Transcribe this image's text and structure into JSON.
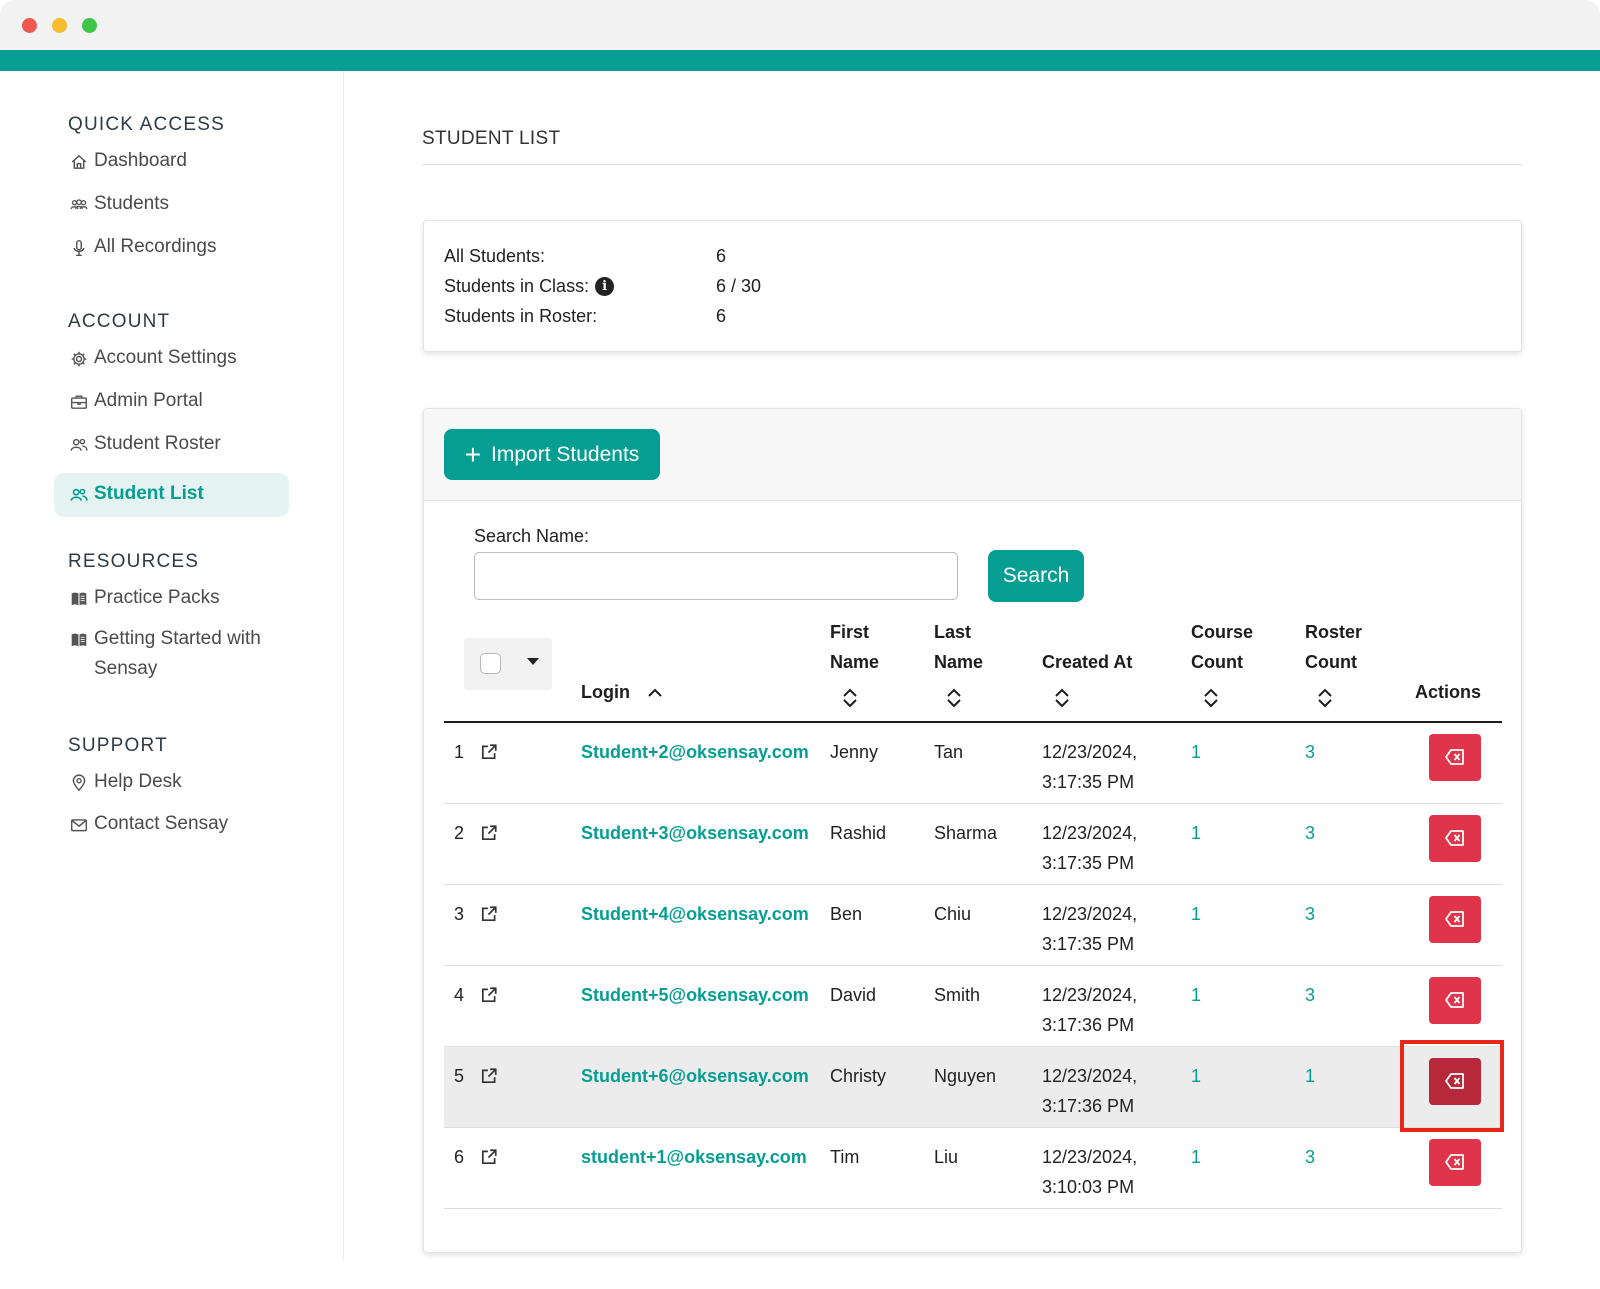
{
  "sidebar": {
    "sections": [
      {
        "title": "QUICK ACCESS",
        "items": [
          {
            "label": "Dashboard",
            "icon": "home-icon"
          },
          {
            "label": "Students",
            "icon": "users-icon"
          },
          {
            "label": "All Recordings",
            "icon": "microphone-icon"
          }
        ]
      },
      {
        "title": "ACCOUNT",
        "items": [
          {
            "label": "Account Settings",
            "icon": "gear-icon"
          },
          {
            "label": "Admin Portal",
            "icon": "briefcase-icon"
          },
          {
            "label": "Student Roster",
            "icon": "people-icon"
          },
          {
            "label": "Student List",
            "icon": "people-icon",
            "active": true
          }
        ]
      },
      {
        "title": "RESOURCES",
        "items": [
          {
            "label": "Practice Packs",
            "icon": "book-icon"
          },
          {
            "label": "Getting Started with Sensay",
            "icon": "book-icon"
          }
        ]
      },
      {
        "title": "SUPPORT",
        "items": [
          {
            "label": "Help Desk",
            "icon": "location-icon"
          },
          {
            "label": "Contact Sensay",
            "icon": "mail-icon"
          }
        ]
      }
    ]
  },
  "page": {
    "title": "STUDENT LIST"
  },
  "stats": {
    "all_students_label": "All Students:",
    "all_students_value": "6",
    "in_class_label": "Students in Class:",
    "in_class_value": "6 / 30",
    "in_roster_label": "Students in Roster:",
    "in_roster_value": "6"
  },
  "toolbar": {
    "import_label": "Import Students"
  },
  "search": {
    "label": "Search Name:",
    "value": "",
    "placeholder": "",
    "button_label": "Search"
  },
  "table": {
    "headers": {
      "login": "Login",
      "first_name": [
        "First",
        "Name"
      ],
      "last_name": [
        "Last",
        "Name"
      ],
      "created_at": "Created At",
      "course_count": [
        "Course",
        "Count"
      ],
      "roster_count": [
        "Roster",
        "Count"
      ],
      "actions": "Actions"
    },
    "rows": [
      {
        "num": "1",
        "login": "Student+2@oksensay.com",
        "first": "Jenny",
        "last": "Tan",
        "date": "12/23/2024,",
        "time": "3:17:35 PM",
        "course": "1",
        "roster": "3"
      },
      {
        "num": "2",
        "login": "Student+3@oksensay.com",
        "first": "Rashid",
        "last": "Sharma",
        "date": "12/23/2024,",
        "time": "3:17:35 PM",
        "course": "1",
        "roster": "3"
      },
      {
        "num": "3",
        "login": "Student+4@oksensay.com",
        "first": "Ben",
        "last": "Chiu",
        "date": "12/23/2024,",
        "time": "3:17:35 PM",
        "course": "1",
        "roster": "3"
      },
      {
        "num": "4",
        "login": "Student+5@oksensay.com",
        "first": "David",
        "last": "Smith",
        "date": "12/23/2024,",
        "time": "3:17:36 PM",
        "course": "1",
        "roster": "3"
      },
      {
        "num": "5",
        "login": "Student+6@oksensay.com",
        "first": "Christy",
        "last": "Nguyen",
        "date": "12/23/2024,",
        "time": "3:17:36 PM",
        "course": "1",
        "roster": "1"
      },
      {
        "num": "6",
        "login": "student+1@oksensay.com",
        "first": "Tim",
        "last": "Liu",
        "date": "12/23/2024,",
        "time": "3:10:03 PM",
        "course": "1",
        "roster": "3"
      }
    ]
  },
  "colors": {
    "accent": "#069e92",
    "danger": "#e0344a",
    "highlight": "#e8261a"
  }
}
